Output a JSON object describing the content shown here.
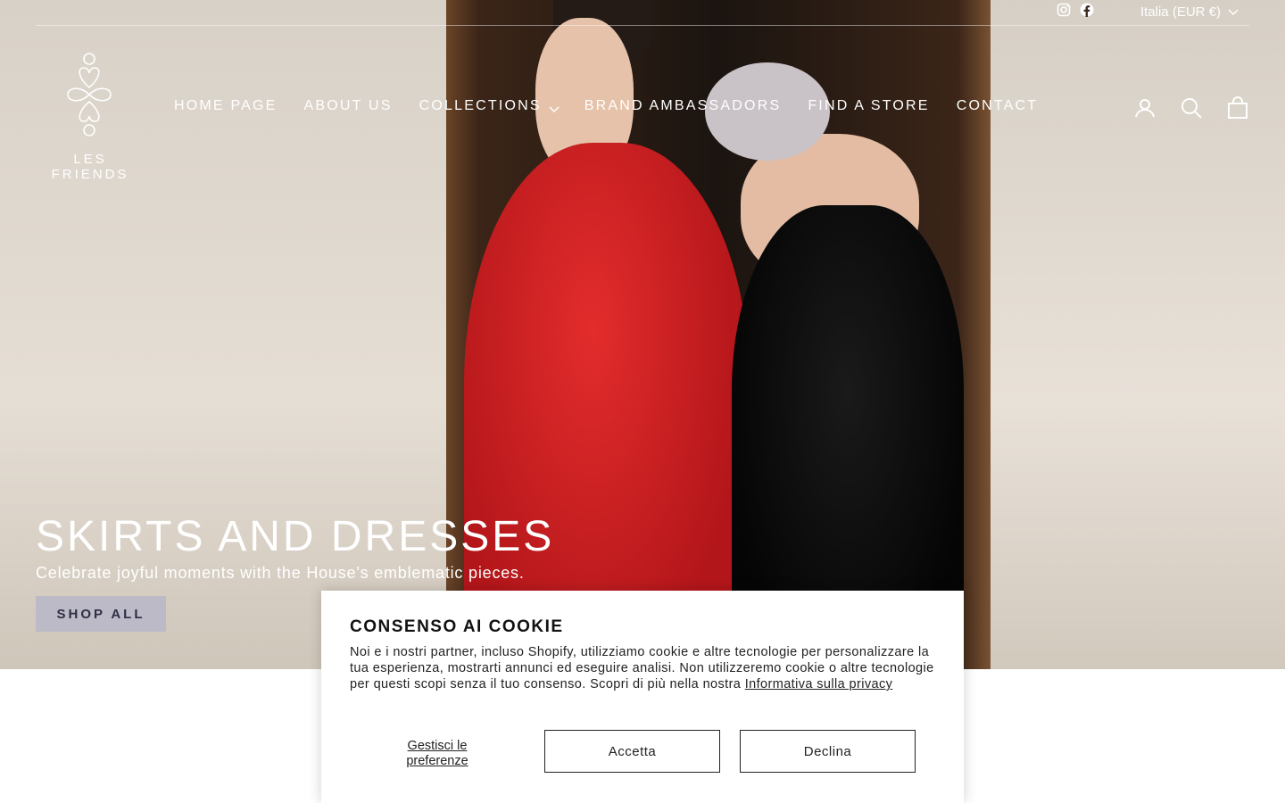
{
  "topbar": {
    "social": [
      {
        "icon": "instagram-icon"
      },
      {
        "icon": "facebook-icon"
      }
    ],
    "currency_label": "Italia (EUR €)"
  },
  "logo": {
    "text": "LES FRIENDS"
  },
  "nav": {
    "items": [
      {
        "label": "HOME PAGE"
      },
      {
        "label": "ABOUT US"
      },
      {
        "label": "COLLECTIONS"
      },
      {
        "label": "BRAND AMBASSADORS"
      },
      {
        "label": "FIND A STORE"
      },
      {
        "label": "CONTACT"
      }
    ]
  },
  "actions": {
    "icons": [
      "account-icon",
      "search-icon",
      "cart-icon"
    ]
  },
  "hero": {
    "title": "SKIRTS AND DRESSES",
    "subtitle": "Celebrate joyful moments with the House's emblematic pieces.",
    "button_label": "SHOP ALL"
  },
  "cookie": {
    "title": "CONSENSO AI COOKIE",
    "body": "Noi e i nostri partner, incluso Shopify, utilizziamo cookie e altre tecnologie per personalizzare la tua esperienza, mostrarti annunci ed eseguire analisi. Non utilizzeremo cookie o altre tecnologie per questi scopi senza il tuo consenso. Scopri di più nella nostra",
    "privacy_link": "Informativa sulla privacy",
    "manage_label": "Gestisci le preferenze",
    "accept_label": "Accetta",
    "decline_label": "Declina"
  }
}
